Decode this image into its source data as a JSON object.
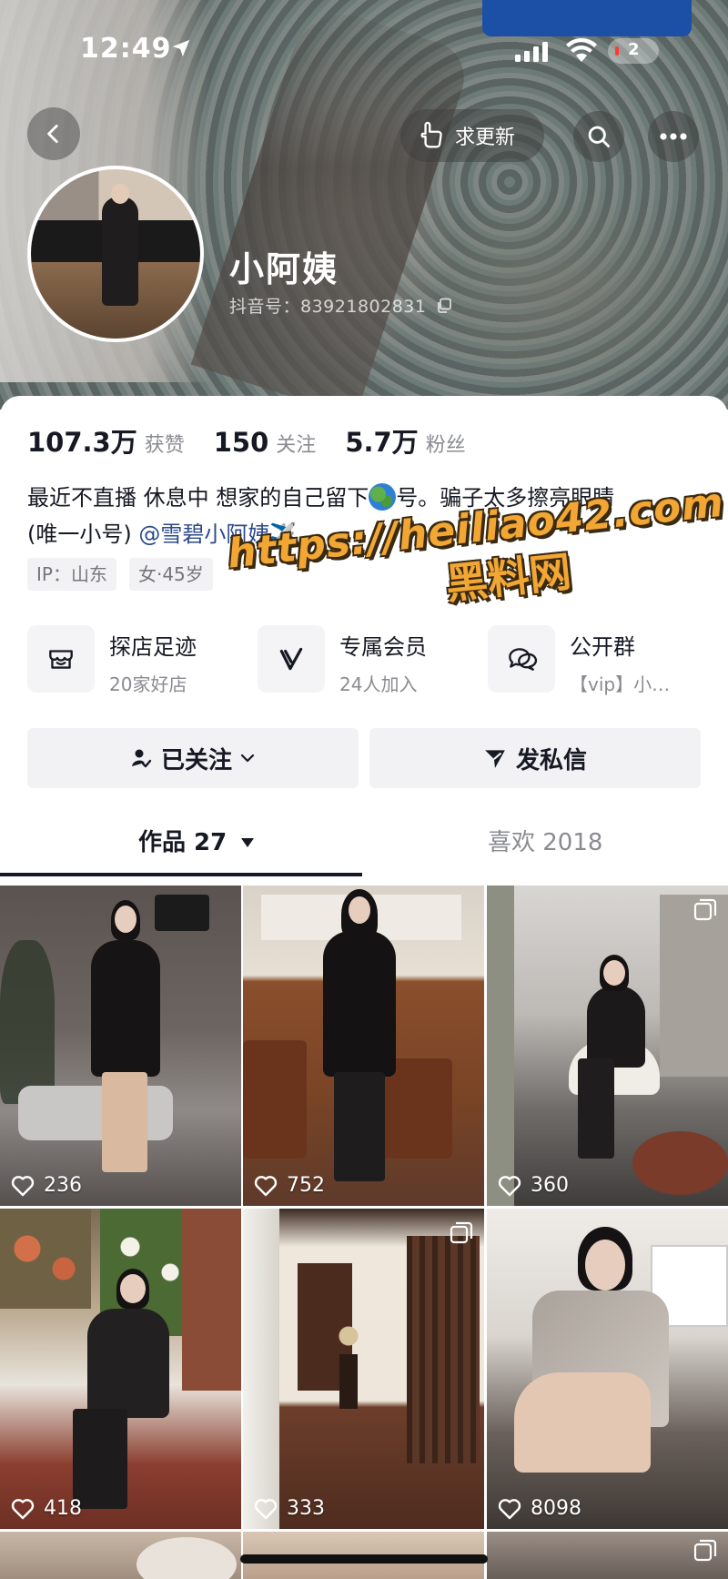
{
  "status_bar": {
    "time": "12:49",
    "battery": "2"
  },
  "header": {
    "update_label": "求更新"
  },
  "profile": {
    "name": "小阿姨",
    "douyin_id": "抖音号：83921802831"
  },
  "stats": [
    {
      "value": "107.3万",
      "label": "获赞"
    },
    {
      "value": "150",
      "label": "关注"
    },
    {
      "value": "5.7万",
      "label": "粉丝"
    }
  ],
  "bio": {
    "line1_before": "最近不直播 休息中 想家的自己留下",
    "line1_after": "号。骗子太多擦亮眼睛",
    "line2_prefix": "(唯一小号) ",
    "mention": "@雪碧小阿姨✈️"
  },
  "tags": [
    "IP：山东",
    "女·45岁"
  ],
  "watermark": {
    "url": "https://heiliao42.com",
    "name": "黑料网"
  },
  "features": [
    {
      "title": "探店足迹",
      "subtitle": "20家好店",
      "icon": "shop-icon"
    },
    {
      "title": "专属会员",
      "subtitle": "24人加入",
      "icon": "vip-icon"
    },
    {
      "title": "公开群",
      "subtitle": "【vip】小…",
      "icon": "chat-icon"
    }
  ],
  "actions": {
    "following_label": "已关注",
    "message_label": "发私信"
  },
  "tabs": {
    "works_label": "作品 27",
    "likes_label": "喜欢 2018"
  },
  "videos": [
    {
      "likes": "236"
    },
    {
      "likes": "752"
    },
    {
      "likes": "360"
    },
    {
      "likes": "418"
    },
    {
      "likes": "333"
    },
    {
      "likes": "8098"
    }
  ],
  "colors": {
    "accent_text": "#161823",
    "secondary_text": "#8a8b91",
    "link": "#2b4a8a",
    "watermark": "#f2a634"
  }
}
